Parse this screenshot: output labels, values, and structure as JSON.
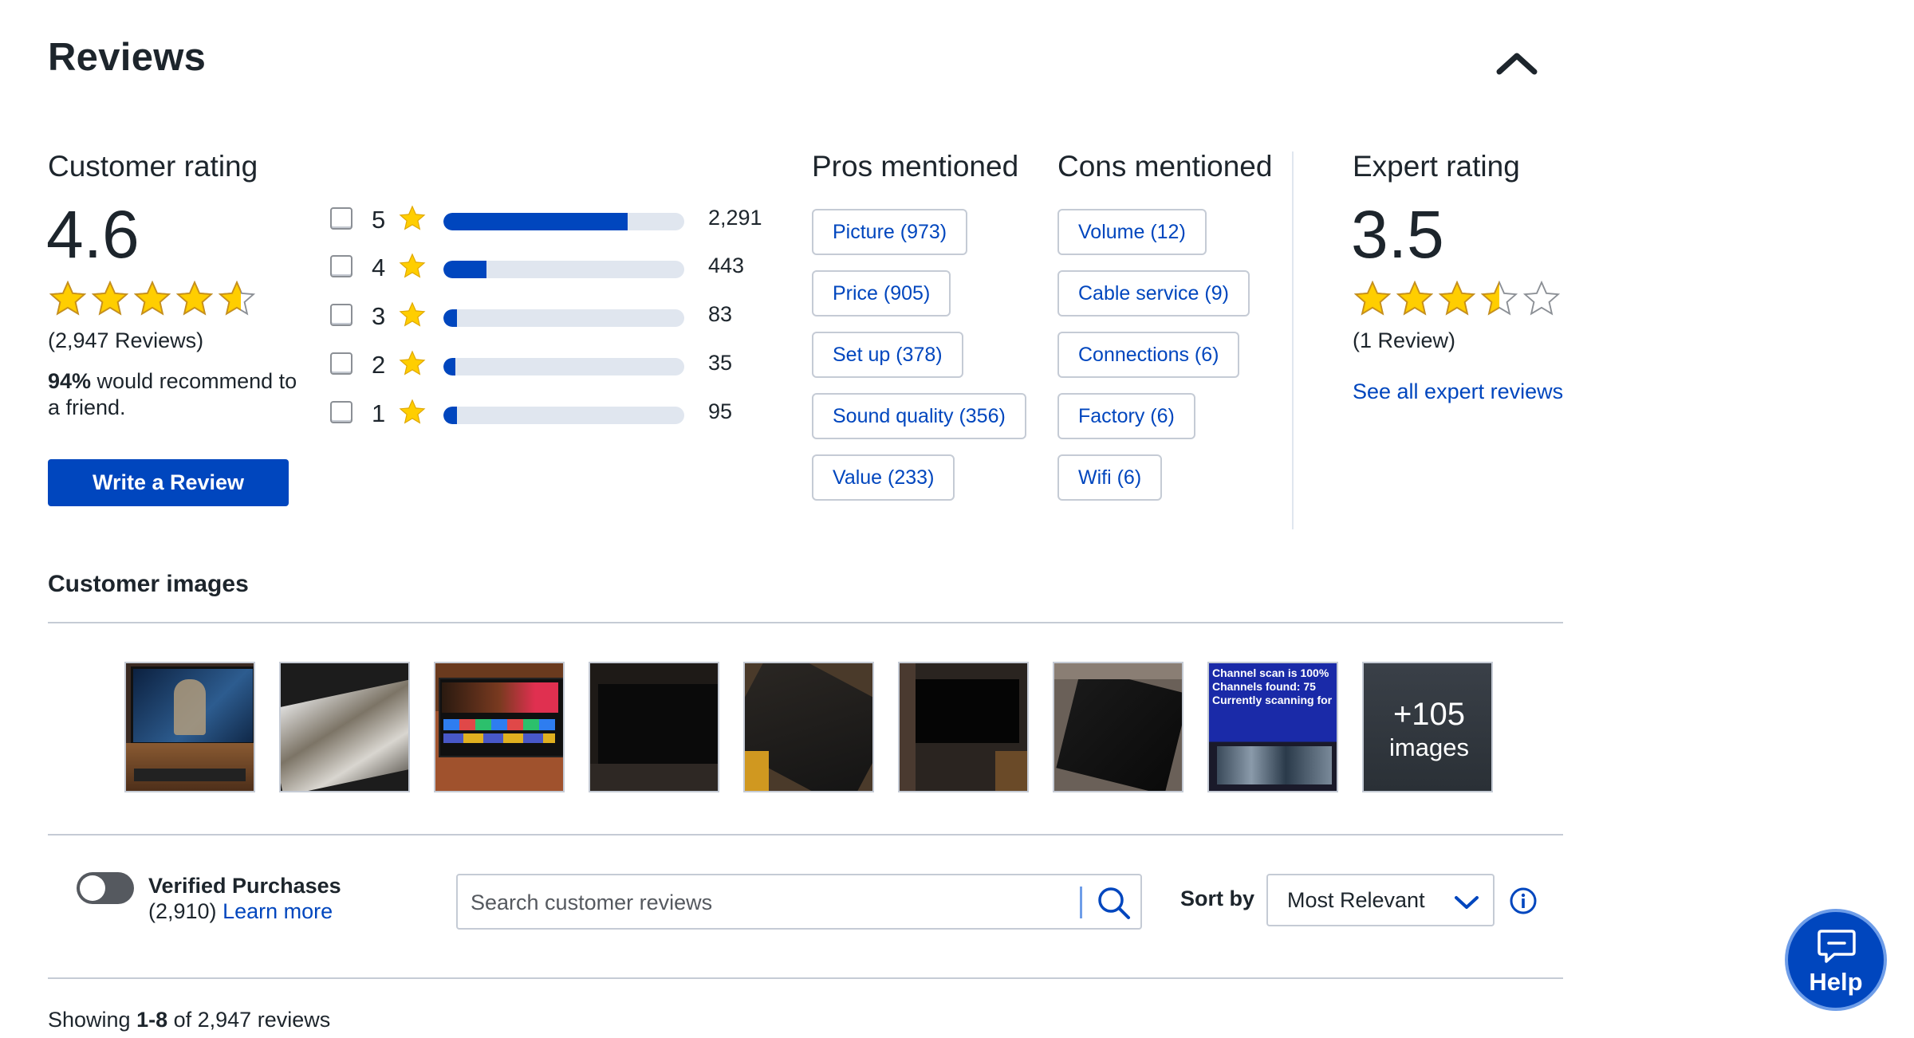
{
  "header": {
    "title": "Reviews"
  },
  "customer_rating": {
    "heading": "Customer rating",
    "score": "4.6",
    "score_value": 4.6,
    "review_count": "(2,947 Reviews)",
    "recommend_pct": "94%",
    "recommend_text": " would recommend to a friend.",
    "write_review_label": "Write a Review"
  },
  "histogram": [
    {
      "stars": "5",
      "count": "2,291",
      "fraction": 0.765
    },
    {
      "stars": "4",
      "count": "443",
      "fraction": 0.18
    },
    {
      "stars": "3",
      "count": "83",
      "fraction": 0.055
    },
    {
      "stars": "2",
      "count": "35",
      "fraction": 0.05
    },
    {
      "stars": "1",
      "count": "95",
      "fraction": 0.055
    }
  ],
  "pros": {
    "heading": "Pros mentioned",
    "items": [
      "Picture (973)",
      "Price (905)",
      "Set up (378)",
      "Sound quality (356)",
      "Value (233)"
    ]
  },
  "cons": {
    "heading": "Cons mentioned",
    "items": [
      "Volume (12)",
      "Cable service (9)",
      "Connections (6)",
      "Factory (6)",
      "Wifi (6)"
    ]
  },
  "expert_rating": {
    "heading": "Expert rating",
    "score": "3.5",
    "score_value": 3.5,
    "review_count": "(1 Review)",
    "see_all_link": "See all expert reviews"
  },
  "customer_images": {
    "heading": "Customer images",
    "channel_scan_text": [
      "Channel scan is 100%",
      "Channels found: 75",
      "Currently scanning for"
    ],
    "more_count": "+105",
    "more_label": "images"
  },
  "filters": {
    "verified_label": "Verified Purchases",
    "verified_count": "(2,910)",
    "learn_more": "Learn more",
    "search_placeholder": "Search customer reviews",
    "sort_label": "Sort by",
    "sort_value": "Most Relevant"
  },
  "results": {
    "showing_prefix": "Showing ",
    "showing_range": "1-8",
    "showing_suffix": " of 2,947 reviews"
  },
  "help": {
    "label": "Help"
  },
  "colors": {
    "accent": "#0046be",
    "star": "#ffce00",
    "track": "#e0e6ef",
    "border": "#c5cbd5"
  }
}
